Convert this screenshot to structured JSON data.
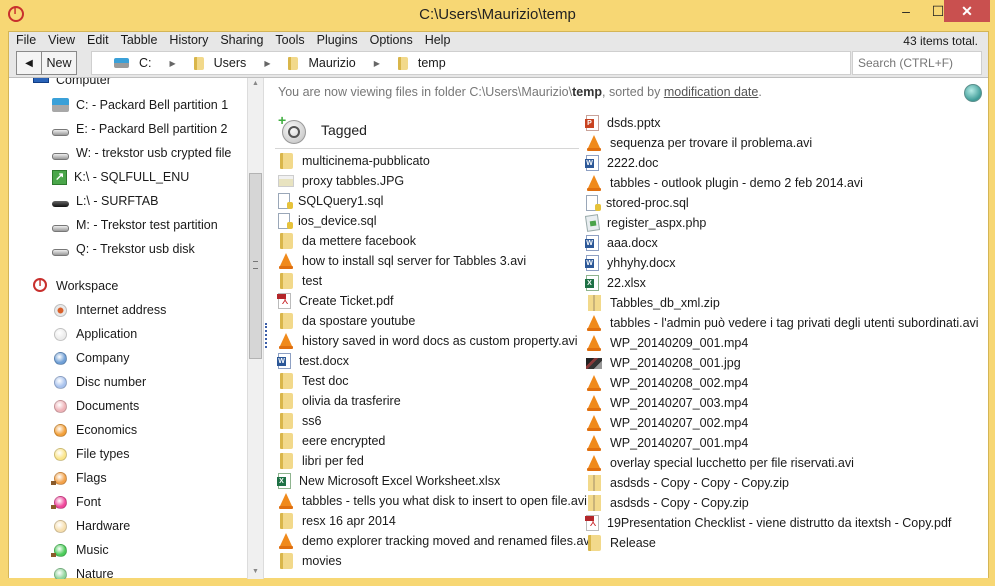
{
  "window": {
    "title": "C:\\Users\\Maurizio\\temp",
    "minimize_glyph": "–",
    "maximize_glyph": "☐",
    "close_glyph": "✕"
  },
  "menu": {
    "items": [
      "File",
      "View",
      "Edit",
      "Tabble",
      "History",
      "Sharing",
      "Tools",
      "Plugins",
      "Options",
      "Help"
    ],
    "items_total": "43 items total."
  },
  "nav": {
    "back_glyph": "◀",
    "new_label": "New",
    "breadcrumb": [
      {
        "label": "C:",
        "icon": "drive-icon"
      },
      {
        "label": "Users",
        "icon": "folder-icon"
      },
      {
        "label": "Maurizio",
        "icon": "folder-icon"
      },
      {
        "label": "temp",
        "icon": "folder-icon"
      }
    ],
    "separator_glyph": "▶",
    "search_placeholder": "Search (CTRL+F)"
  },
  "sidebar": {
    "computer_label": "Computer",
    "drives": [
      {
        "label": "C: - Packard Bell partition 1",
        "icon": "drive-c"
      },
      {
        "label": "E: - Packard Bell partition 2",
        "icon": "drive"
      },
      {
        "label": "W: - trekstor usb crypted file",
        "icon": "drive"
      },
      {
        "label": "K:\\ - SQLFULL_ENU",
        "icon": "shortcut"
      },
      {
        "label": "L:\\ - SURFTAB",
        "icon": "drive-black"
      },
      {
        "label": "M: - Trekstor test partition",
        "icon": "drive"
      },
      {
        "label": "Q: - Trekstor usb disk",
        "icon": "drive"
      }
    ],
    "workspace_label": "Workspace",
    "tags": [
      {
        "label": "Internet address",
        "color": "#e8e8e8",
        "accent": "#d9602a",
        "shadow": false
      },
      {
        "label": "Application",
        "color": "#ececec",
        "shadow": false
      },
      {
        "label": "Company",
        "color": "#6f9fd6",
        "shadow": false
      },
      {
        "label": "Disc number",
        "color": "#a9c3ee",
        "shadow": false
      },
      {
        "label": "Documents",
        "color": "#efb3b8",
        "shadow": false
      },
      {
        "label": "Economics",
        "color": "#f2a03b",
        "shadow": false
      },
      {
        "label": "File types",
        "color": "#fbe58a",
        "shadow": false
      },
      {
        "label": "Flags",
        "color": "#f3a24a",
        "shadow": true
      },
      {
        "label": "Font",
        "color": "#f0479b",
        "shadow": true
      },
      {
        "label": "Hardware",
        "color": "#f7dfae",
        "shadow": false
      },
      {
        "label": "Music",
        "color": "#4ccc5a",
        "shadow": true
      },
      {
        "label": "Nature",
        "color": "#8fd49a",
        "shadow": false
      }
    ]
  },
  "main": {
    "info_prefix": "You are now viewing files in folder C:\\Users\\Maurizio\\",
    "info_folder": "temp",
    "info_middle": ", sorted by ",
    "info_sort": "modification date",
    "info_suffix": ".",
    "tagged_label": "Tagged",
    "files_col1": [
      {
        "name": "multicinema-pubblicato",
        "icon": "folder"
      },
      {
        "name": "proxy tabbles.JPG",
        "icon": "jpg"
      },
      {
        "name": "SQLQuery1.sql",
        "icon": "sql"
      },
      {
        "name": "ios_device.sql",
        "icon": "sql"
      },
      {
        "name": "da mettere facebook",
        "icon": "folder"
      },
      {
        "name": "how to install sql server for Tabbles 3.avi",
        "icon": "vlc"
      },
      {
        "name": "test",
        "icon": "folder"
      },
      {
        "name": "Create Ticket.pdf",
        "icon": "pdf"
      },
      {
        "name": "da spostare youtube",
        "icon": "folder"
      },
      {
        "name": "history saved in word docs as custom property.avi",
        "icon": "vlc"
      },
      {
        "name": "test.docx",
        "icon": "doc"
      },
      {
        "name": "Test doc",
        "icon": "folder"
      },
      {
        "name": "olivia da trasferire",
        "icon": "folder"
      },
      {
        "name": "ss6",
        "icon": "folder"
      },
      {
        "name": "eere encrypted",
        "icon": "folder"
      },
      {
        "name": "libri per fed",
        "icon": "folder"
      },
      {
        "name": "New Microsoft Excel Worksheet.xlsx",
        "icon": "xls"
      },
      {
        "name": "tabbles - tells you what disk to insert to open file.avi",
        "icon": "vlc"
      },
      {
        "name": "resx 16 apr 2014",
        "icon": "folder"
      },
      {
        "name": "demo explorer tracking moved and renamed files.avi",
        "icon": "vlc"
      },
      {
        "name": "movies",
        "icon": "folder"
      }
    ],
    "files_col2": [
      {
        "name": "dsds.pptx",
        "icon": "ppt"
      },
      {
        "name": "sequenza per trovare il problema.avi",
        "icon": "vlc"
      },
      {
        "name": "2222.doc",
        "icon": "doc"
      },
      {
        "name": "tabbles - outlook plugin - demo 2 feb 2014.avi",
        "icon": "vlc"
      },
      {
        "name": "stored-proc.sql",
        "icon": "sql"
      },
      {
        "name": "register_aspx.php",
        "icon": "php"
      },
      {
        "name": "aaa.docx",
        "icon": "doc"
      },
      {
        "name": "yhhyhy.docx",
        "icon": "doc"
      },
      {
        "name": "22.xlsx",
        "icon": "xls"
      },
      {
        "name": "Tabbles_db_xml.zip",
        "icon": "zip"
      },
      {
        "name": "tabbles - l'admin può vedere i tag privati degli utenti subordinati.avi",
        "icon": "vlc"
      },
      {
        "name": "WP_20140209_001.mp4",
        "icon": "vlc"
      },
      {
        "name": "WP_20140208_001.jpg",
        "icon": "photo"
      },
      {
        "name": "WP_20140208_002.mp4",
        "icon": "vlc"
      },
      {
        "name": "WP_20140207_003.mp4",
        "icon": "vlc"
      },
      {
        "name": "WP_20140207_002.mp4",
        "icon": "vlc"
      },
      {
        "name": "WP_20140207_001.mp4",
        "icon": "vlc"
      },
      {
        "name": "overlay special lucchetto per file riservati.avi",
        "icon": "vlc"
      },
      {
        "name": "asdsds - Copy - Copy - Copy.zip",
        "icon": "zip"
      },
      {
        "name": "asdsds - Copy - Copy.zip",
        "icon": "zip"
      },
      {
        "name": "19Presentation Checklist - viene distrutto da itextsh - Copy.pdf",
        "icon": "pdf"
      },
      {
        "name": "Release",
        "icon": "folder"
      }
    ]
  },
  "scrollbar": {
    "up_glyph": "▲",
    "down_glyph": "▼"
  }
}
